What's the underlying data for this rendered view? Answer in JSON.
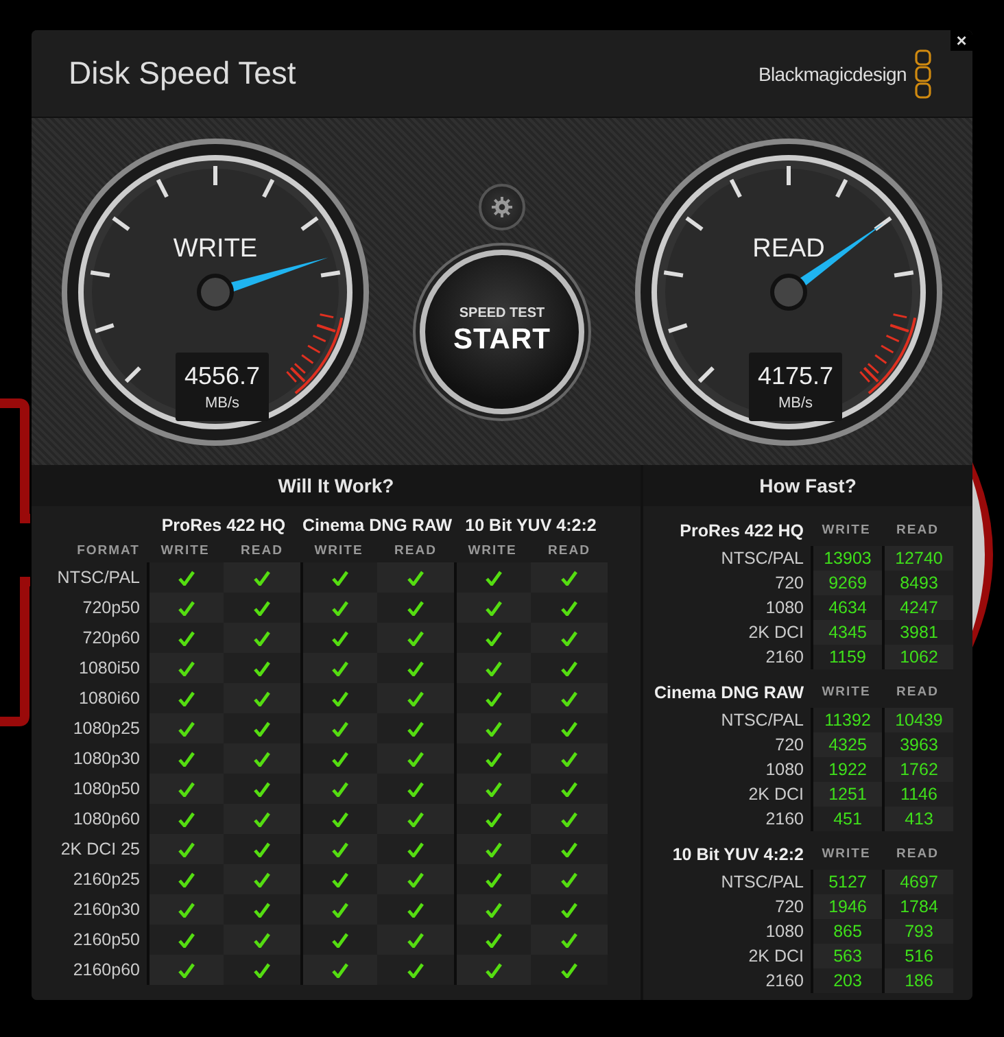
{
  "window": {
    "title": "Disk Speed Test",
    "brand": "Blackmagicdesign",
    "close": "×"
  },
  "gauges": [
    {
      "label": "WRITE",
      "reading": "4556.7",
      "unit": "MB/s",
      "level": 0.77
    },
    {
      "label": "READ",
      "reading": "4175.7",
      "unit": "MB/s",
      "level": 0.7
    }
  ],
  "start_button": {
    "caption": "SPEED TEST",
    "label": "START"
  },
  "will_it_work": {
    "title": "Will It Work?",
    "format_label": "FORMAT",
    "groups": [
      {
        "name": "ProRes 422 HQ",
        "columns": [
          "WRITE",
          "READ"
        ]
      },
      {
        "name": "Cinema DNG RAW",
        "columns": [
          "WRITE",
          "READ"
        ]
      },
      {
        "name": "10 Bit YUV 4:2:2",
        "columns": [
          "WRITE",
          "READ"
        ]
      }
    ],
    "rows": [
      {
        "format": "NTSC/PAL",
        "results": [
          true,
          true,
          true,
          true,
          true,
          true
        ]
      },
      {
        "format": "720p50",
        "results": [
          true,
          true,
          true,
          true,
          true,
          true
        ]
      },
      {
        "format": "720p60",
        "results": [
          true,
          true,
          true,
          true,
          true,
          true
        ]
      },
      {
        "format": "1080i50",
        "results": [
          true,
          true,
          true,
          true,
          true,
          true
        ]
      },
      {
        "format": "1080i60",
        "results": [
          true,
          true,
          true,
          true,
          true,
          true
        ]
      },
      {
        "format": "1080p25",
        "results": [
          true,
          true,
          true,
          true,
          true,
          true
        ]
      },
      {
        "format": "1080p30",
        "results": [
          true,
          true,
          true,
          true,
          true,
          true
        ]
      },
      {
        "format": "1080p50",
        "results": [
          true,
          true,
          true,
          true,
          true,
          true
        ]
      },
      {
        "format": "1080p60",
        "results": [
          true,
          true,
          true,
          true,
          true,
          true
        ]
      },
      {
        "format": "2K DCI 25",
        "results": [
          true,
          true,
          true,
          true,
          true,
          true
        ]
      },
      {
        "format": "2160p25",
        "results": [
          true,
          true,
          true,
          true,
          true,
          true
        ]
      },
      {
        "format": "2160p30",
        "results": [
          true,
          true,
          true,
          true,
          true,
          true
        ]
      },
      {
        "format": "2160p50",
        "results": [
          true,
          true,
          true,
          true,
          true,
          true
        ]
      },
      {
        "format": "2160p60",
        "results": [
          true,
          true,
          true,
          true,
          true,
          true
        ]
      }
    ]
  },
  "how_fast": {
    "title": "How Fast?",
    "groups": [
      {
        "name": "ProRes 422 HQ",
        "columns": [
          "WRITE",
          "READ"
        ],
        "rows": [
          {
            "label": "NTSC/PAL",
            "write": "13903",
            "read": "12740"
          },
          {
            "label": "720",
            "write": "9269",
            "read": "8493"
          },
          {
            "label": "1080",
            "write": "4634",
            "read": "4247"
          },
          {
            "label": "2K DCI",
            "write": "4345",
            "read": "3981"
          },
          {
            "label": "2160",
            "write": "1159",
            "read": "1062"
          }
        ]
      },
      {
        "name": "Cinema DNG RAW",
        "columns": [
          "WRITE",
          "READ"
        ],
        "rows": [
          {
            "label": "NTSC/PAL",
            "write": "11392",
            "read": "10439"
          },
          {
            "label": "720",
            "write": "4325",
            "read": "3963"
          },
          {
            "label": "1080",
            "write": "1922",
            "read": "1762"
          },
          {
            "label": "2K DCI",
            "write": "1251",
            "read": "1146"
          },
          {
            "label": "2160",
            "write": "451",
            "read": "413"
          }
        ]
      },
      {
        "name": "10 Bit YUV 4:2:2",
        "columns": [
          "WRITE",
          "READ"
        ],
        "rows": [
          {
            "label": "NTSC/PAL",
            "write": "5127",
            "read": "4697"
          },
          {
            "label": "720",
            "write": "1946",
            "read": "1784"
          },
          {
            "label": "1080",
            "write": "865",
            "read": "793"
          },
          {
            "label": "2K DCI",
            "write": "563",
            "read": "516"
          },
          {
            "label": "2160",
            "write": "203",
            "read": "186"
          }
        ]
      }
    ]
  }
}
